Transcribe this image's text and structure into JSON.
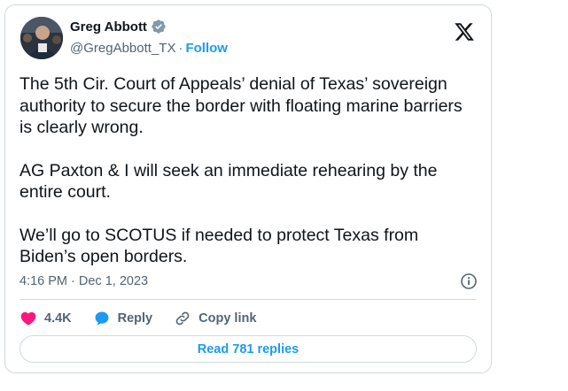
{
  "author": {
    "display_name": "Greg Abbott",
    "handle": "@GregAbbott_TX",
    "separator": "·",
    "follow_label": "Follow"
  },
  "tweet": {
    "paragraphs": [
      "The 5th Cir. Court of Appeals’ denial of Texas’ sovereign authority to secure the border with floating marine barriers is clearly wrong.",
      "AG Paxton & I will seek an immediate rehearing by the entire court.",
      "We’ll go to SCOTUS if needed to protect Texas from Biden’s open borders."
    ],
    "timestamp": "4:16 PM · Dec 1, 2023"
  },
  "actions": {
    "likes": "4.4K",
    "reply_label": "Reply",
    "copy_link_label": "Copy link"
  },
  "replies_button": "Read 781 replies",
  "colors": {
    "accent": "#1d9bf0",
    "like": "#f91880",
    "verified": "#829aab",
    "text": "#0f1419",
    "secondary": "#536471",
    "border": "#cfd9de"
  },
  "icons": {
    "verified": "verified-badge-icon",
    "logo": "x-logo-icon",
    "info": "info-icon",
    "like": "heart-icon",
    "reply": "reply-bubble-icon",
    "copy_link": "link-icon"
  }
}
